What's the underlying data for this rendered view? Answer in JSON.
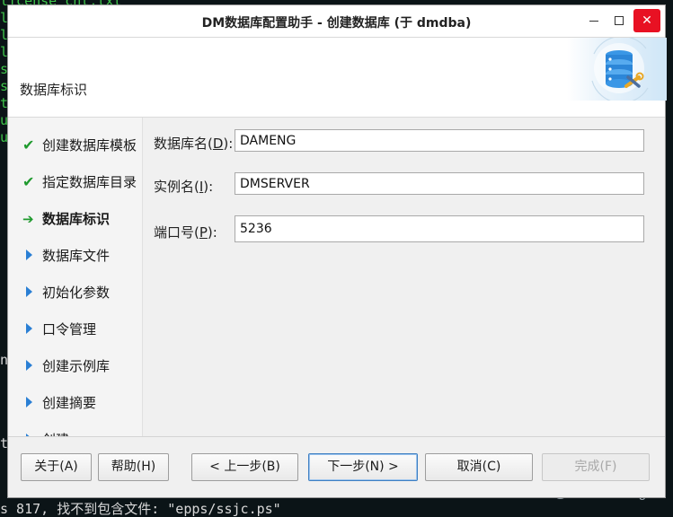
{
  "terminal": {
    "top_line": "license cnt.txt",
    "side_chars": [
      "l",
      "l",
      "l",
      "s",
      "s",
      "t",
      "u",
      "u"
    ],
    "side_chars_lower": [
      "n",
      "t"
    ],
    "bottom_line": "s 817, 找不到包含文件: \"epps/ssjc.ps\""
  },
  "watermark": "CSDN @GottdesKrieges",
  "window": {
    "title": "DM数据库配置助手 - 创建数据库 (于 dmdba)",
    "controls": {
      "minimize": "minimize",
      "maximize": "maximize",
      "close": "✕"
    }
  },
  "header": {
    "label": "数据库标识",
    "art_icon": "database-config-icon"
  },
  "steps": [
    {
      "label": "创建数据库模板",
      "status": "done"
    },
    {
      "label": "指定数据库目录",
      "status": "done"
    },
    {
      "label": "数据库标识",
      "status": "current"
    },
    {
      "label": "数据库文件",
      "status": "pending"
    },
    {
      "label": "初始化参数",
      "status": "pending"
    },
    {
      "label": "口令管理",
      "status": "pending"
    },
    {
      "label": "创建示例库",
      "status": "pending"
    },
    {
      "label": "创建摘要",
      "status": "pending"
    },
    {
      "label": "创建",
      "status": "pending"
    }
  ],
  "form": {
    "db_name": {
      "label_pre": "数据库名(",
      "mnemonic": "D",
      "label_post": "):",
      "value": "DAMENG"
    },
    "instance": {
      "label_pre": "实例名(",
      "mnemonic": "I",
      "label_post": "):",
      "value": "DMSERVER"
    },
    "port": {
      "label_pre": "端口号(",
      "mnemonic": "P",
      "label_post": "):",
      "value": "5236"
    }
  },
  "buttons": {
    "about": "关于(A)",
    "help": "帮助(H)",
    "prev": "< 上一步(B)",
    "next": "下一步(N) >",
    "cancel": "取消(C)",
    "finish": "完成(F)"
  },
  "colors": {
    "check": "#1f9a2e",
    "pending_triangle": "#2a7fd4",
    "close_button": "#e81123",
    "terminal_text": "#3fc44a"
  }
}
